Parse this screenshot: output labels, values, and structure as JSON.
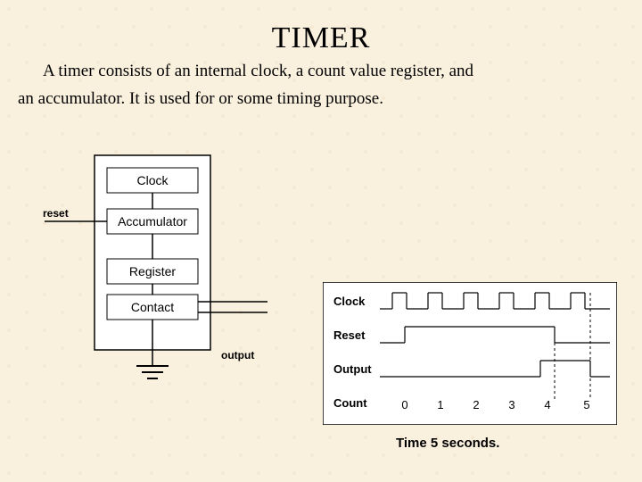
{
  "title": "TIMER",
  "desc_line1": "A timer consists of an internal clock, a count value register, and",
  "desc_line2": "an accumulator. It is used for or some timing purpose.",
  "block_diagram": {
    "reset_label": "reset",
    "output_label": "output",
    "blocks": [
      "Clock",
      "Accumulator",
      "Register",
      "Contact"
    ]
  },
  "timing_diagram": {
    "signals": [
      "Clock",
      "Reset",
      "Output",
      "Count"
    ],
    "counts": [
      "0",
      "1",
      "2",
      "3",
      "4",
      "5"
    ]
  },
  "caption": "Time 5 seconds."
}
